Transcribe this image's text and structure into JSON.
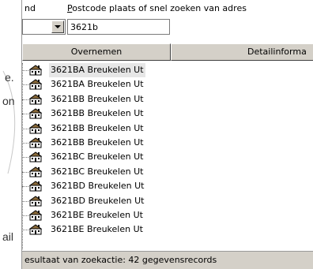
{
  "background": {
    "fragments": [
      "e.",
      "on",
      "ail"
    ]
  },
  "panel": {
    "header_land": "nd",
    "header_postcode_prefix": "P",
    "header_postcode_rest": "ostcode plaats of snel zoeken van adres",
    "search_value": "3621b",
    "overnemen_label": "Overnemen",
    "detail_label": "Detailinforma",
    "status_text": "esultaat van zoekactie: 42 gegevensrecords",
    "results": [
      {
        "label": "3621BA Breukelen Ut",
        "icon": "building-icon",
        "selected": true
      },
      {
        "label": "3621BA Breukelen Ut",
        "icon": "building-icon"
      },
      {
        "label": "3621BB Breukelen Ut",
        "icon": "building-icon"
      },
      {
        "label": "3621BB Breukelen Ut",
        "icon": "building-icon"
      },
      {
        "label": "3621BB Breukelen Ut",
        "icon": "building-icon"
      },
      {
        "label": "3621BB Breukelen Ut",
        "icon": "building-icon"
      },
      {
        "label": "3621BC Breukelen Ut",
        "icon": "building-icon"
      },
      {
        "label": "3621BC Breukelen Ut",
        "icon": "building-icon"
      },
      {
        "label": "3621BD Breukelen Ut",
        "icon": "building-icon"
      },
      {
        "label": "3621BD Breukelen Ut",
        "icon": "building-icon"
      },
      {
        "label": "3621BE Breukelen Ut",
        "icon": "building-icon"
      },
      {
        "label": "3621BE Breukelen Ut",
        "icon": "building-icon"
      }
    ]
  },
  "colors": {
    "button_face": "#d4d0c8",
    "selection": "#e6e6e6"
  }
}
